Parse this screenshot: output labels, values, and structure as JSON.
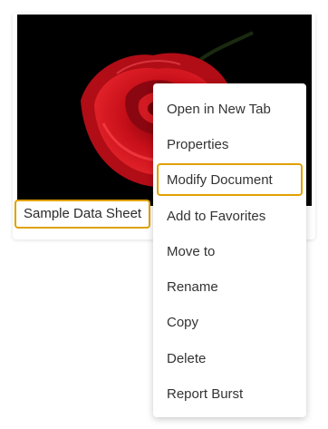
{
  "document": {
    "title": "Sample Data Sheet",
    "thumbnail_icon": "rose-image"
  },
  "context_menu": {
    "items": [
      {
        "label": "Open in New Tab",
        "name": "open-in-new-tab"
      },
      {
        "label": "Properties",
        "name": "properties"
      },
      {
        "label": "Modify Document",
        "name": "modify-document",
        "selected": true
      },
      {
        "label": "Add to Favorites",
        "name": "add-to-favorites"
      },
      {
        "label": "Move to",
        "name": "move-to"
      },
      {
        "label": "Rename",
        "name": "rename"
      },
      {
        "label": "Copy",
        "name": "copy"
      },
      {
        "label": "Delete",
        "name": "delete"
      },
      {
        "label": "Report Burst",
        "name": "report-burst"
      }
    ]
  },
  "colors": {
    "highlight": "#e0a100",
    "thumbnail_background": "#000000",
    "rose": "#c8101a"
  }
}
